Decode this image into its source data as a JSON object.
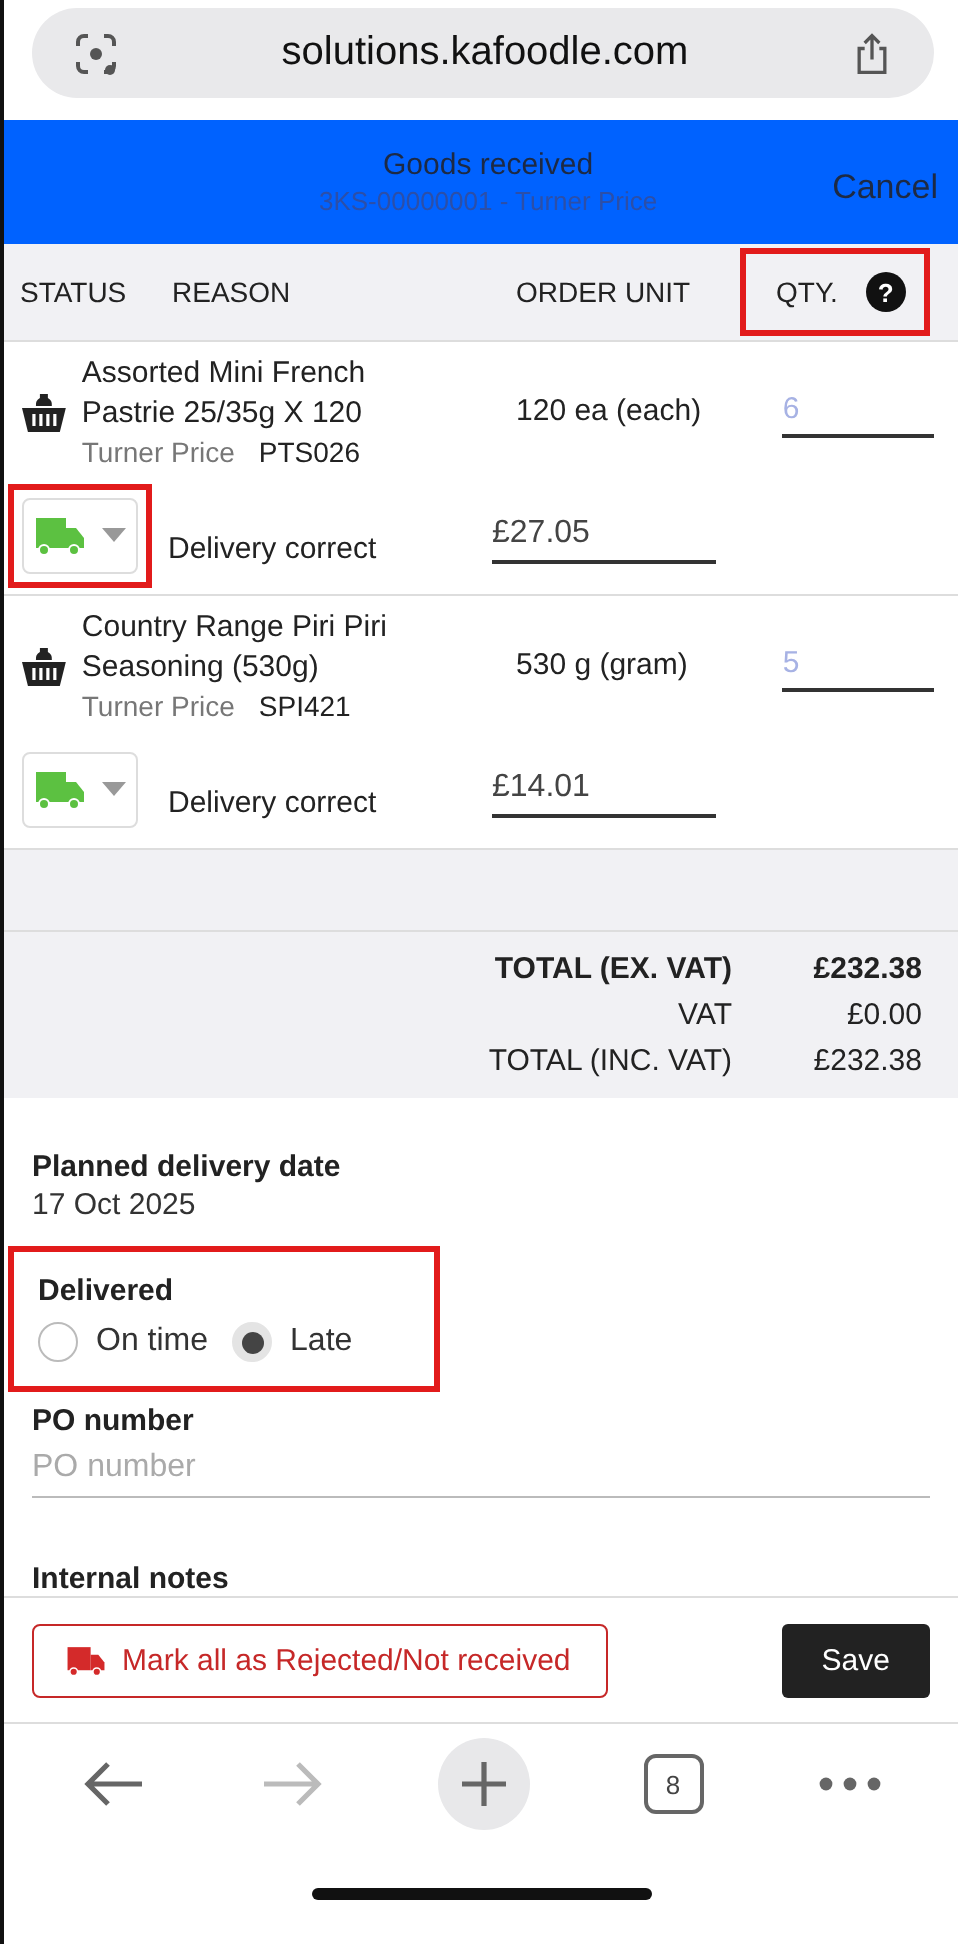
{
  "browser": {
    "url": "solutions.kafoodle.com",
    "tab_count": "8"
  },
  "header": {
    "title": "Goods received",
    "subtitle": "3KS-00000001 - Turner Price",
    "cancel": "Cancel"
  },
  "table": {
    "columns": [
      {
        "label": "STATUS",
        "highlighted": false
      },
      {
        "label": "REASON",
        "highlighted": false
      },
      {
        "label": "ORDER UNIT",
        "highlighted": false
      },
      {
        "label": "QTY.",
        "highlighted": true,
        "help": "?"
      }
    ],
    "rows": [
      {
        "name": "Assorted Mini French Pastrie 25/35g X 120",
        "supplier": "Turner Price",
        "code": "PTS026",
        "unit": "120 ea (each)",
        "qty": "6",
        "status": "Delivery correct",
        "status_highlighted": true,
        "price": "£27.05"
      },
      {
        "name": "Country Range Piri Piri Seasoning (530g)",
        "supplier": "Turner Price",
        "code": "SPI421",
        "unit": "530 g (gram)",
        "qty": "5",
        "status": "Delivery correct",
        "status_highlighted": false,
        "price": "£14.01"
      }
    ]
  },
  "totals": [
    {
      "label": "TOTAL (EX. VAT)",
      "value": "£232.38",
      "bold": true
    },
    {
      "label": "VAT",
      "value": "£0.00",
      "bold": false
    },
    {
      "label": "TOTAL (INC. VAT)",
      "value": "£232.38",
      "bold": false
    }
  ],
  "planned_delivery": {
    "label": "Planned delivery date",
    "value": "17 Oct 2025"
  },
  "delivered": {
    "label": "Delivered",
    "highlighted": true,
    "options": [
      {
        "label": "On time",
        "selected": false
      },
      {
        "label": "Late",
        "selected": true
      }
    ]
  },
  "po_number": {
    "label": "PO number",
    "placeholder": "PO number"
  },
  "internal_notes": {
    "label": "Internal notes"
  },
  "footer": {
    "reject": "Mark all as Rejected/Not received",
    "save": "Save"
  }
}
